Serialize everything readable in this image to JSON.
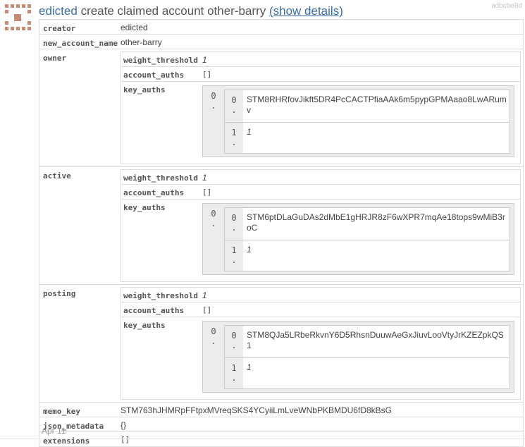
{
  "header": {
    "user": "edicted",
    "action": "create claimed account other-barry",
    "details_link": "(show details)",
    "txid": "adbcbe8d"
  },
  "fields": {
    "creator": {
      "key": "creator",
      "value": "edicted"
    },
    "new_account_name": {
      "key": "new_account_name",
      "value": "other-barry"
    },
    "owner": {
      "key": "owner",
      "weight_threshold_key": "weight_threshold",
      "weight_threshold": "1",
      "account_auths_key": "account_auths",
      "account_auths": "[]",
      "key_auths_key": "key_auths",
      "outer_index": "0",
      "pub_key_index": "0",
      "pub_key": "STM8RHRfovJikft5DR4PcCACTPfiaAAk6m5pypGPMAaao8LwARumv",
      "weight_index": "1",
      "weight": "1"
    },
    "active": {
      "key": "active",
      "weight_threshold_key": "weight_threshold",
      "weight_threshold": "1",
      "account_auths_key": "account_auths",
      "account_auths": "[]",
      "key_auths_key": "key_auths",
      "outer_index": "0",
      "pub_key_index": "0",
      "pub_key": "STM6ptDLaGuDAs2dMbE1gHRJR8zF6wXPR7mqAe18tops9wMiB3roC",
      "weight_index": "1",
      "weight": "1"
    },
    "posting": {
      "key": "posting",
      "weight_threshold_key": "weight_threshold",
      "weight_threshold": "1",
      "account_auths_key": "account_auths",
      "account_auths": "[]",
      "key_auths_key": "key_auths",
      "outer_index": "0",
      "pub_key_index": "0",
      "pub_key": "STM8QJa5LRbeRkvnY6D5RhsnDuuwAeGxJiuvLooVtyJrKZEZpkQS1",
      "weight_index": "1",
      "weight": "1"
    },
    "memo_key": {
      "key": "memo_key",
      "value": "STM763hJHMRpFFtpxMVreqSKS4YCyiiLmLveWNbPKBMDU6fD8kBsG"
    },
    "json_metadata": {
      "key": "json_metadata",
      "value": "{}"
    },
    "extensions": {
      "key": "extensions",
      "value": "[]"
    }
  },
  "date": "Apr 11",
  "colors": {
    "link": "#3a6ea5",
    "avatar": "#c98a73",
    "border": "#dddddd"
  },
  "icons": {
    "avatar": "identicon-avatar"
  }
}
